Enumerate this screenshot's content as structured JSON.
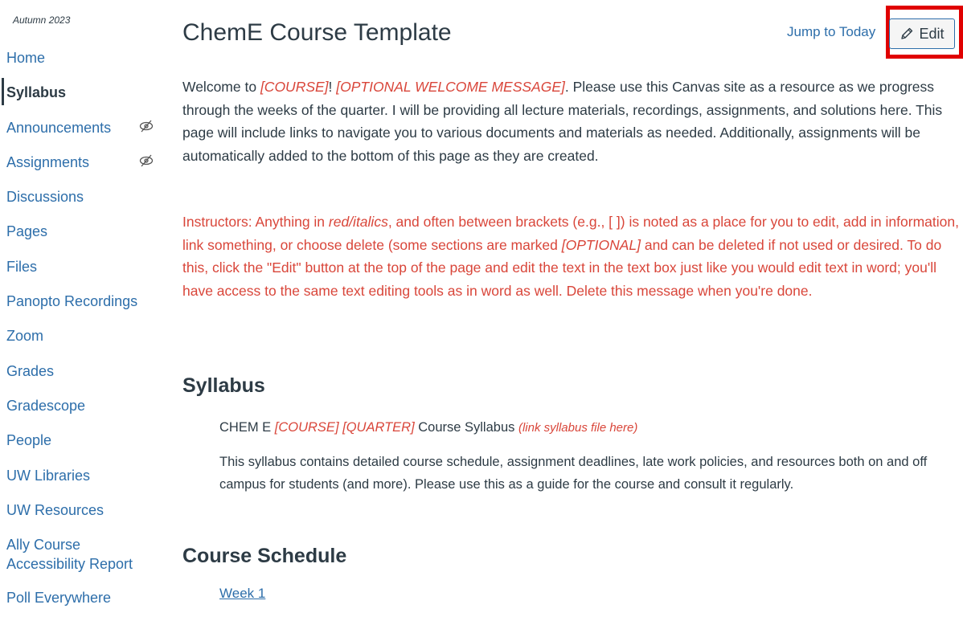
{
  "sidebar": {
    "term": "Autumn 2023",
    "items": [
      {
        "label": "Home"
      },
      {
        "label": "Syllabus"
      },
      {
        "label": "Announcements"
      },
      {
        "label": "Assignments"
      },
      {
        "label": "Discussions"
      },
      {
        "label": "Pages"
      },
      {
        "label": "Files"
      },
      {
        "label": "Panopto Recordings"
      },
      {
        "label": "Zoom"
      },
      {
        "label": "Grades"
      },
      {
        "label": "Gradescope"
      },
      {
        "label": "People"
      },
      {
        "label": "UW Libraries"
      },
      {
        "label": "UW Resources"
      },
      {
        "label": "Ally Course Accessibility Report"
      },
      {
        "label": "Poll Everywhere"
      }
    ]
  },
  "header": {
    "title": "ChemE Course Template",
    "jump_label": "Jump to Today",
    "edit_label": "Edit"
  },
  "welcome": {
    "t1": "Welcome to ",
    "r1": "[COURSE]",
    "t2": "! ",
    "r2": "[OPTIONAL WELCOME MESSAGE]",
    "t3": ". Please use this Canvas site as a resource as we progress through the weeks of the quarter. I will be providing all lecture materials, recordings, assignments, and solutions here. This page will include links to navigate you to various documents and materials as needed. Additionally, assignments will be automatically added to the bottom of this page as they are created."
  },
  "instructors": {
    "t1": "Instructors: Anything in ",
    "i1": "red/italics",
    "t2": ", and often between brackets (e.g., [ ]) is noted as a place for you to edit, add in information, link something, or choose delete (some sections are marked ",
    "i2": "[OPTIONAL]",
    "t3": " and can be deleted if not used or desired. To do this, click the \"Edit\" button at the top of the page and edit the text in the text box just like you would edit text in word; you'll have access to the same text editing tools as in word as well. Delete this message when you're done."
  },
  "syllabus": {
    "heading": "Syllabus",
    "line_prefix": "CHEM E ",
    "line_red": "[COURSE] [QUARTER]",
    "line_mid": " Course Syllabus ",
    "line_link": "(link syllabus file here)",
    "description": "This syllabus contains detailed course schedule, assignment deadlines, late work policies, and resources both on and off campus for students (and more). Please use this as a guide for the course and consult it regularly."
  },
  "schedule": {
    "heading": "Course Schedule",
    "week_link": "Week 1"
  },
  "colors": {
    "link": "#2d6eaa",
    "text": "#2d3b45",
    "red_note": "#d9463a",
    "highlight": "#e00000"
  }
}
